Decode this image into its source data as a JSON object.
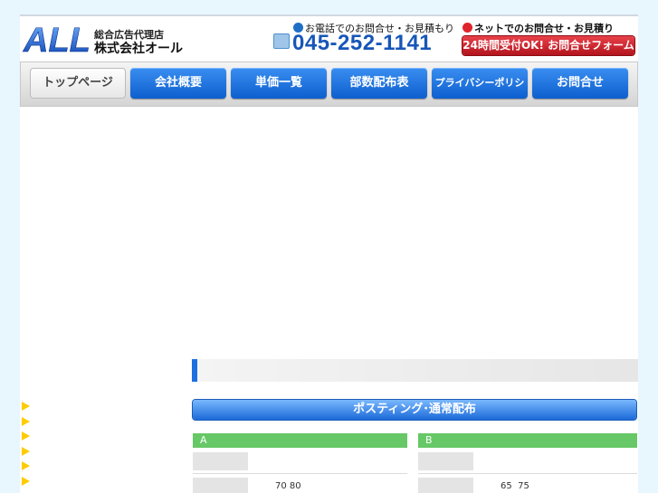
{
  "brand": {
    "logo_text": "ALL",
    "tagline": "総合広告代理店",
    "company_name": "株式会社オール"
  },
  "contact": {
    "phone_label": "お電話でのお問合せ・お見積もり",
    "phone_number": "045-252-1141",
    "net_label": "ネットでのお問合せ・お見積り",
    "net_button": "24時間受付OK! お問合せフォーム"
  },
  "nav": {
    "items": [
      {
        "label": "トップページ",
        "active": true
      },
      {
        "label": "会社概要",
        "active": false
      },
      {
        "label": "単価一覧",
        "active": false
      },
      {
        "label": "部数配布表",
        "active": false
      },
      {
        "label": "プライバシーポリシー",
        "active": false
      },
      {
        "label": "お問合せ",
        "active": false
      }
    ]
  },
  "main": {
    "posting_title": "ポスティング･通常配布",
    "columns": [
      {
        "header": "A",
        "value": "70 80"
      },
      {
        "header": "B",
        "value": "65  75"
      }
    ]
  },
  "colors": {
    "nav_blue": "#1469d8",
    "accent_red": "#c8161f",
    "column_green": "#66c866",
    "arrow_yellow": "#ffcc00"
  }
}
